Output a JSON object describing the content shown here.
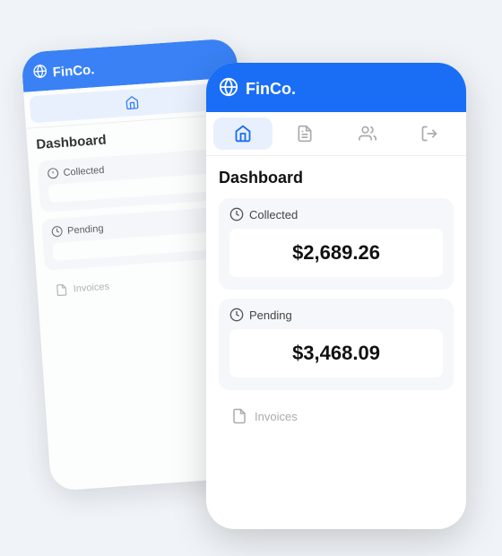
{
  "app": {
    "name": "FinCo.",
    "globe_icon": "🌐"
  },
  "nav": {
    "items": [
      {
        "id": "home",
        "label": "Home",
        "active": true
      },
      {
        "id": "documents",
        "label": "Documents",
        "active": false
      },
      {
        "id": "users",
        "label": "Users",
        "active": false
      },
      {
        "id": "logout",
        "label": "Logout",
        "active": false
      }
    ]
  },
  "dashboard": {
    "title": "Dashboard",
    "cards": [
      {
        "id": "collected",
        "label": "Collected",
        "value": "$2,689.26"
      },
      {
        "id": "pending",
        "label": "Pending",
        "value": "$3,468.09"
      }
    ],
    "invoices_label": "Invoices"
  },
  "colors": {
    "primary": "#1a6ef5",
    "nav_active_bg": "#e8f0fe",
    "card_bg": "#f5f7fa"
  }
}
